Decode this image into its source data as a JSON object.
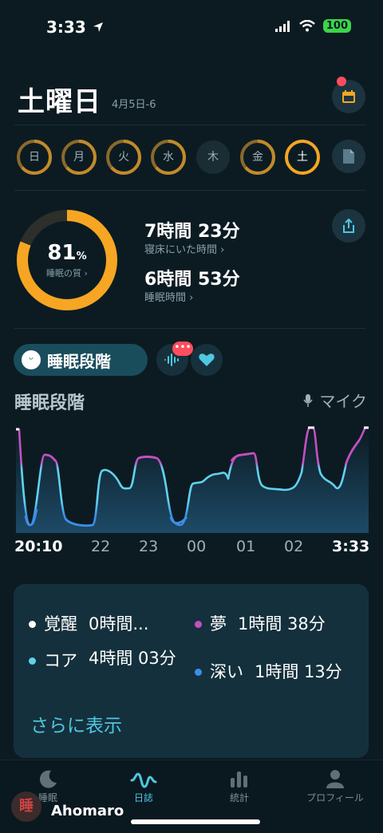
{
  "status": {
    "time": "3:33",
    "battery": "100"
  },
  "header": {
    "day": "土曜日",
    "date": "4月5日-6"
  },
  "week": {
    "days": [
      {
        "label": "日",
        "filled": true
      },
      {
        "label": "月",
        "filled": true
      },
      {
        "label": "火",
        "filled": true
      },
      {
        "label": "水",
        "filled": true
      },
      {
        "label": "木",
        "filled": false
      },
      {
        "label": "金",
        "filled": true
      },
      {
        "label": "土",
        "filled": true,
        "selected": true
      }
    ]
  },
  "quality": {
    "percent_value": "81",
    "percent_unit": "%",
    "label": "睡眠の質 ›",
    "fraction": 0.81,
    "in_bed_time": "7時間 23分",
    "in_bed_label": "寝床にいた時間 ›",
    "asleep_time": "6時間 53分",
    "asleep_label": "睡眠時間 ›"
  },
  "segments": {
    "stage_label": "睡眠段階",
    "mic_badge": "•••"
  },
  "chart": {
    "title": "睡眠段階",
    "mic_label": "マイク",
    "x_labels": [
      "20:10",
      "22",
      "23",
      "00",
      "01",
      "02",
      "3:33"
    ]
  },
  "summary": {
    "awake_label": "覚醒",
    "awake_value": "0時間...",
    "rem_label": "夢",
    "rem_value": "1時間 38分",
    "core_label": "コア",
    "core_value": "4時間 03分",
    "deep_label": "深い",
    "deep_value": "1時間 13分",
    "more": "さらに表示"
  },
  "colors": {
    "awake": "#ffffff",
    "rem": "#c54fc0",
    "core": "#5fd2f0",
    "deep": "#3d8ee8",
    "ring": "#f6a623",
    "accent": "#4fc7e0"
  },
  "nav": {
    "sleep": "睡眠",
    "journal": "日誌",
    "stats": "統計",
    "profile": "プロフィール"
  },
  "watermark": {
    "name": "Ahomaro",
    "avatar_char": "睡"
  }
}
